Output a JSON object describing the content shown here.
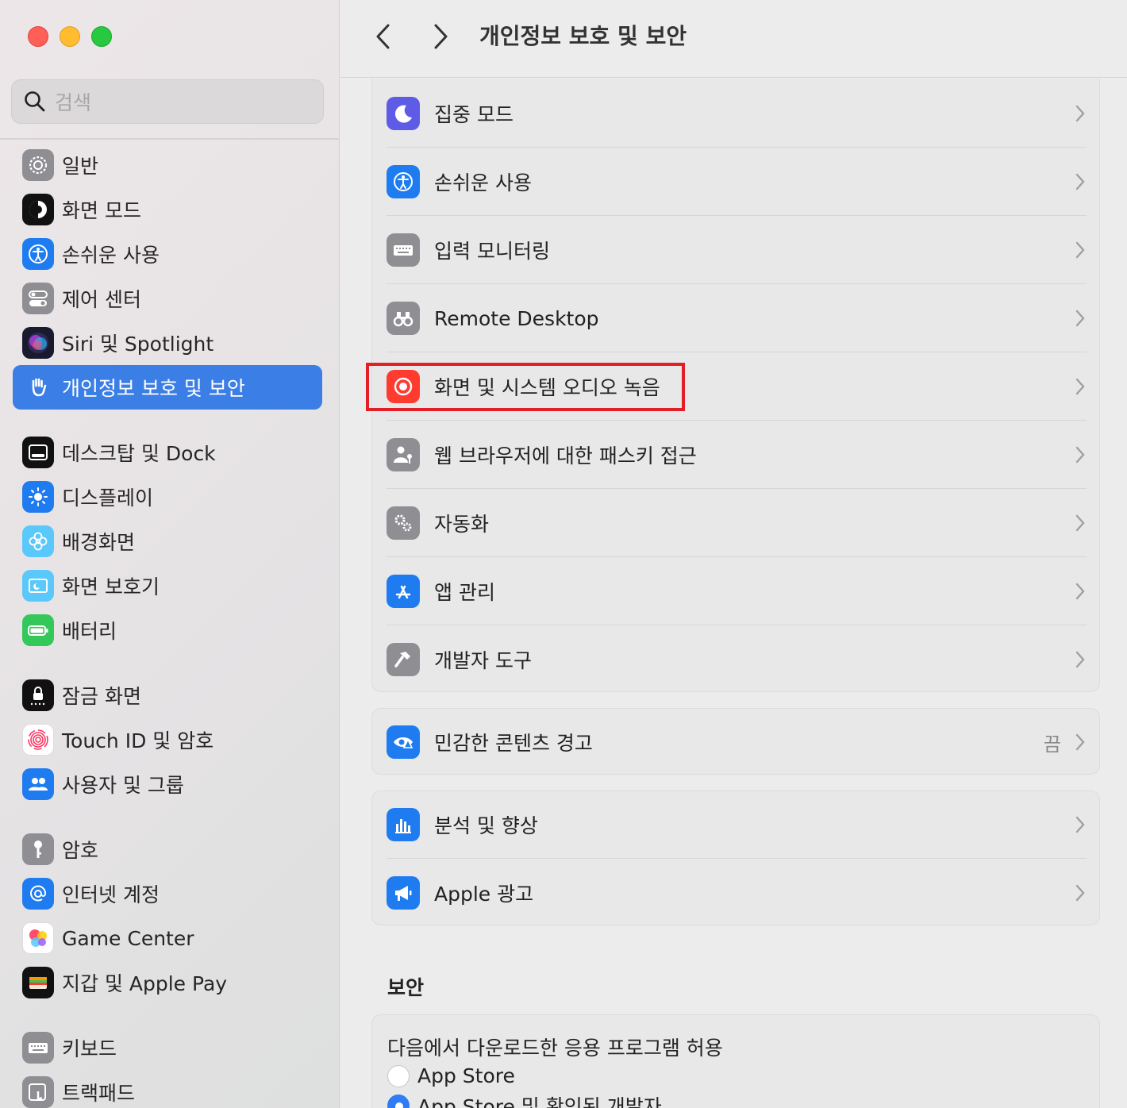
{
  "window": {
    "title": "개인정보 보호 및 보안"
  },
  "search": {
    "placeholder": "검색"
  },
  "sidebar": {
    "items": [
      {
        "label": "일반",
        "icon": "gear-icon"
      },
      {
        "label": "화면 모드",
        "icon": "appearance-icon"
      },
      {
        "label": "손쉬운 사용",
        "icon": "accessibility-icon"
      },
      {
        "label": "제어 센터",
        "icon": "control-center-icon"
      },
      {
        "label": "Siri 및 Spotlight",
        "icon": "siri-icon"
      },
      {
        "label": "개인정보 보호 및 보안",
        "icon": "hand-icon",
        "selected": true
      },
      {
        "label": "데스크탑 및 Dock",
        "icon": "dock-icon"
      },
      {
        "label": "디스플레이",
        "icon": "sun-icon"
      },
      {
        "label": "배경화면",
        "icon": "flower-icon"
      },
      {
        "label": "화면 보호기",
        "icon": "screensaver-icon"
      },
      {
        "label": "배터리",
        "icon": "battery-icon"
      },
      {
        "label": "잠금 화면",
        "icon": "lock-icon"
      },
      {
        "label": "Touch ID 및 암호",
        "icon": "fingerprint-icon"
      },
      {
        "label": "사용자 및 그룹",
        "icon": "users-icon"
      },
      {
        "label": "암호",
        "icon": "key-icon"
      },
      {
        "label": "인터넷 계정",
        "icon": "at-icon"
      },
      {
        "label": "Game Center",
        "icon": "game-center-icon"
      },
      {
        "label": "지갑 및 Apple Pay",
        "icon": "wallet-icon"
      },
      {
        "label": "키보드",
        "icon": "keyboard-icon"
      },
      {
        "label": "트랙패드",
        "icon": "trackpad-icon"
      }
    ]
  },
  "main": {
    "group1": [
      {
        "label": "집중 모드",
        "icon": "moon-icon"
      },
      {
        "label": "손쉬운 사용",
        "icon": "accessibility-icon"
      },
      {
        "label": "입력 모니터링",
        "icon": "keyboard-icon"
      },
      {
        "label": "Remote Desktop",
        "icon": "binoculars-icon"
      },
      {
        "label": "화면 및 시스템 오디오 녹음",
        "icon": "record-icon"
      },
      {
        "label": "웹 브라우저에 대한 패스키 접근",
        "icon": "person-key-icon"
      },
      {
        "label": "자동화",
        "icon": "gears-icon"
      },
      {
        "label": "앱 관리",
        "icon": "app-store-icon"
      },
      {
        "label": "개발자 도구",
        "icon": "hammer-icon"
      }
    ],
    "group2": [
      {
        "label": "민감한 콘텐츠 경고",
        "icon": "eye-warning-icon",
        "value": "끔"
      }
    ],
    "group3": [
      {
        "label": "분석 및 향상",
        "icon": "chart-icon"
      },
      {
        "label": "Apple 광고",
        "icon": "megaphone-icon"
      }
    ],
    "security": {
      "title": "보안",
      "allow_label": "다음에서 다운로드한 응용 프로그램 허용",
      "options": [
        {
          "label": "App Store",
          "selected": false
        },
        {
          "label": "App Store 및 확인된 개발자",
          "selected": true
        }
      ]
    }
  },
  "colors": {
    "accent": "#3b7ee6",
    "highlight_box": "#e21f26"
  }
}
